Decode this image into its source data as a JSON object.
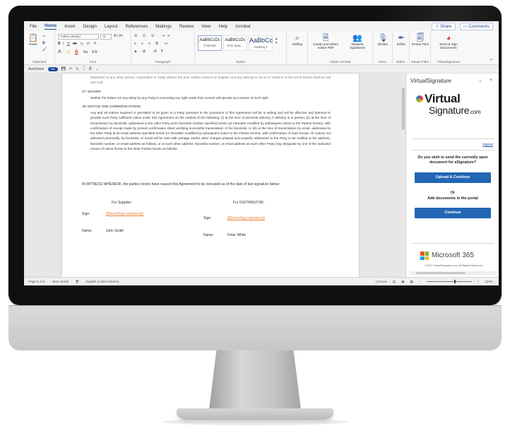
{
  "ribbon_tabs": [
    {
      "label": "File"
    },
    {
      "label": "Home"
    },
    {
      "label": "Insert"
    },
    {
      "label": "Design"
    },
    {
      "label": "Layout"
    },
    {
      "label": "References"
    },
    {
      "label": "Mailings"
    },
    {
      "label": "Review"
    },
    {
      "label": "View"
    },
    {
      "label": "Help"
    },
    {
      "label": "Acrobat"
    }
  ],
  "share_label": "Share",
  "comments_label": "Comments",
  "ribbon": {
    "paste_label": "Paste",
    "font_name": "Calibri (Body)",
    "font_size": "11",
    "style_cells": [
      {
        "sample": "AaBbCcDc",
        "name": "¶ Normal"
      },
      {
        "sample": "AaBbCcDc",
        "name": "¶ No Spac..."
      },
      {
        "sample": "AaBbCc",
        "name": "Heading 1"
      }
    ],
    "editing_label": "Editing",
    "create_share_label": "Create and Share Adobe PDF",
    "request_signatures_label": "Request Signatures",
    "dictate_label": "Dictate",
    "editor_label": "Editor",
    "reuse_files_label": "Reuse Files",
    "send_sign_label": "Send & Sign Documents",
    "groups": {
      "clipboard": "Clipboard",
      "font": "Font",
      "paragraph": "Paragraph",
      "styles": "Styles",
      "adobe": "Adobe Acrobat",
      "voice": "Voice",
      "editor": "Editor",
      "reuse": "Reuse Files",
      "vs": "VirtualSignature"
    }
  },
  "qat": {
    "autosave": "AutoSave",
    "toggle": "Off"
  },
  "document": {
    "top_faded": "Distributor to any other person, corporation or entity without the prior written consent of Supplier and any attempt to do so in violation of the terms hereof shall be null and void.",
    "sec17_title": "17.   WAIVER",
    "sec17_text": "Neither the failure nor any delay by any Party in exercising any right under this License will operate as a waiver of such right.",
    "sec18_title": "18.   NOTICE AND COMMUNICATIONS",
    "sec18_text": "Any and all notices required or permitted to be given to a Party pursuant to the provisions of this Agreement will be in writing and will be effective and deemed to provide such Party sufficient notice under this Agreement on the earliest of the following: (i) at the time of personal delivery, if delivery is in person; (ii) at the time of transmission by facsimile, addressed to the other Party at its facsimile number specified herein (or hereafter modified by subsequent notice to the Parties hereto), with confirmation of receipt made by printed confirmation sheet verifying successful transmission of the facsimile; or (iii) at the time of transmission by email, addressed to the other Party at its email address specified herein (or hereafter modified by subsequent notice to the Parties hereto), with confirmation of read receipt. All notices not delivered personally, by facsimile, or email will be sent with postage and/or other charges prepaid and properly addressed to the Party to be notified at the address, facsimile number, or email address as follows, or at such other address, facsimile number, or email address as such other Party may designate by one of the indicated means of notice herein to the other Parties hereto as follows:",
    "witness": "IN WITNESS WHEREOF, the parties hereto have caused this Agreement to be executed as of the date of last signature below:",
    "for_supplier": "For Supplier:",
    "for_distributor": "For DISTRIBUTOR:",
    "sign_label": "Sign:",
    "sign_tag": "[[$insertSign-signature]]",
    "name_label": "Name:",
    "supplier_name": "John Smith",
    "distributor_name": "Peter White"
  },
  "pane": {
    "title": "VirtualSignature",
    "close": "×",
    "logo_line1": "Virtual",
    "logo_line2": "Signature",
    "logo_com": ".com",
    "logout": "logout",
    "question": "Do you wish to send the currently open document for eSignature?",
    "upload_btn": "Upload & Continue",
    "or": "Or",
    "add_docs": "Add documents in the portal",
    "continue_btn": "Continue",
    "ms_name": "Microsoft 365",
    "copyright": "©2021 VirtualSignature.com All Rights Reserved"
  },
  "status": {
    "page": "Page 6 of 6",
    "words": "4844 words",
    "language": "English (United States)",
    "focus": "Focus",
    "zoom": "120%",
    "zoom_fraction": 0.62
  },
  "colors": {
    "word_blue": "#2b579a",
    "accent_blue": "#2266b3",
    "sign_orange": "#e8853a"
  }
}
